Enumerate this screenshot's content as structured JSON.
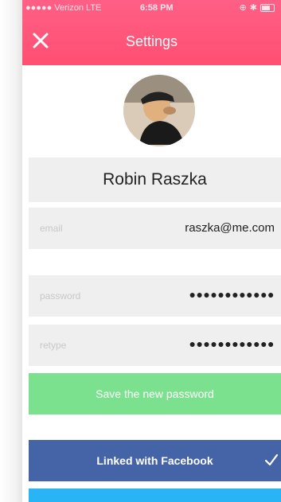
{
  "statusbar": {
    "carrier": "●●●●● Verizon  LTE",
    "time": "6:58 PM",
    "icons": [
      "location-icon",
      "bluetooth-icon",
      "battery-icon"
    ]
  },
  "header": {
    "title": "Settings",
    "close_icon": "close-icon",
    "background": "#ff5a7d"
  },
  "profile": {
    "name": "Robin Raszka"
  },
  "form": {
    "email_label": "email",
    "email_value": "raszka@me.com",
    "password_label": "password",
    "password_value": "●●●●●●●●●●●●",
    "retype_label": "retype",
    "retype_value": "●●●●●●●●●●●●"
  },
  "actions": {
    "save_password_label": "Save the new password",
    "facebook_label": "Linked with Facebook",
    "facebook_status_icon": "checkmark-icon",
    "colors": {
      "save": "#7ce18f",
      "facebook": "#4564a7",
      "twitter": "#29b4f6"
    }
  }
}
